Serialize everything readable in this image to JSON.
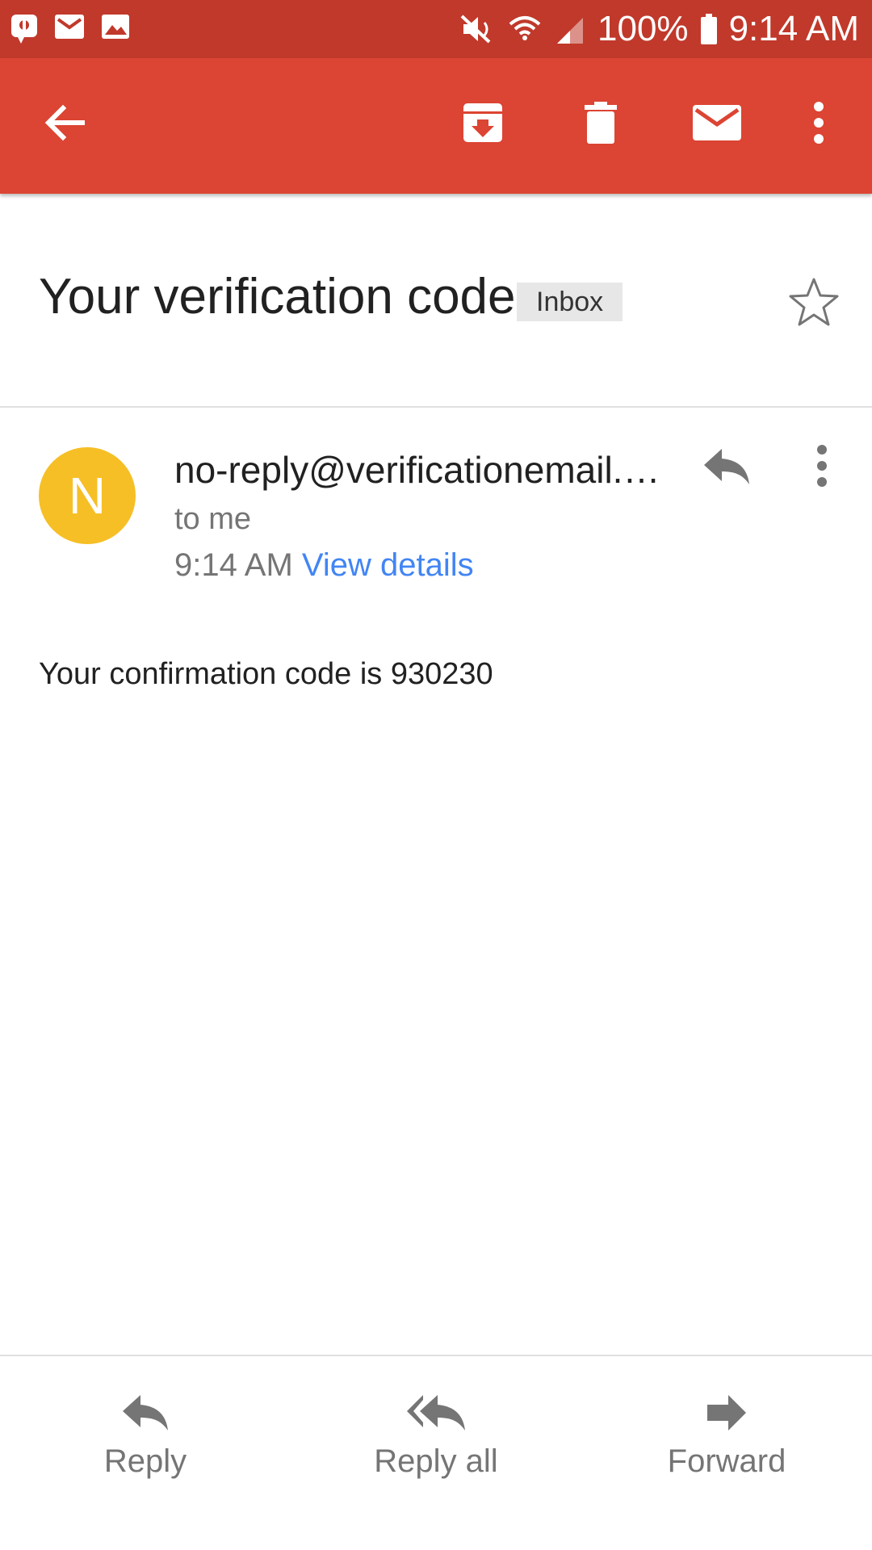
{
  "status_bar": {
    "battery": "100%",
    "time": "9:14 AM",
    "left_icons": [
      "notification-app-icon",
      "gmail-notification-icon",
      "image-notification-icon"
    ],
    "right_icons": [
      "mute-icon",
      "wifi-icon",
      "signal-icon",
      "battery-icon"
    ]
  },
  "toolbar": {
    "icons": [
      "back-arrow-icon",
      "archive-icon",
      "delete-icon",
      "mark-unread-icon",
      "more-vert-icon"
    ],
    "background": "#dc4433"
  },
  "email": {
    "subject": "Your verification code",
    "label": "Inbox",
    "sender": "no-reply@verificationemail.…",
    "avatar_letter": "N",
    "avatar_color": "#f6bf26",
    "recipient": "to me",
    "time": "9:14 AM",
    "view_details": "View details",
    "body": "Your confirmation code is 930230"
  },
  "bottom_actions": {
    "reply": "Reply",
    "reply_all": "Reply all",
    "forward": "Forward"
  }
}
